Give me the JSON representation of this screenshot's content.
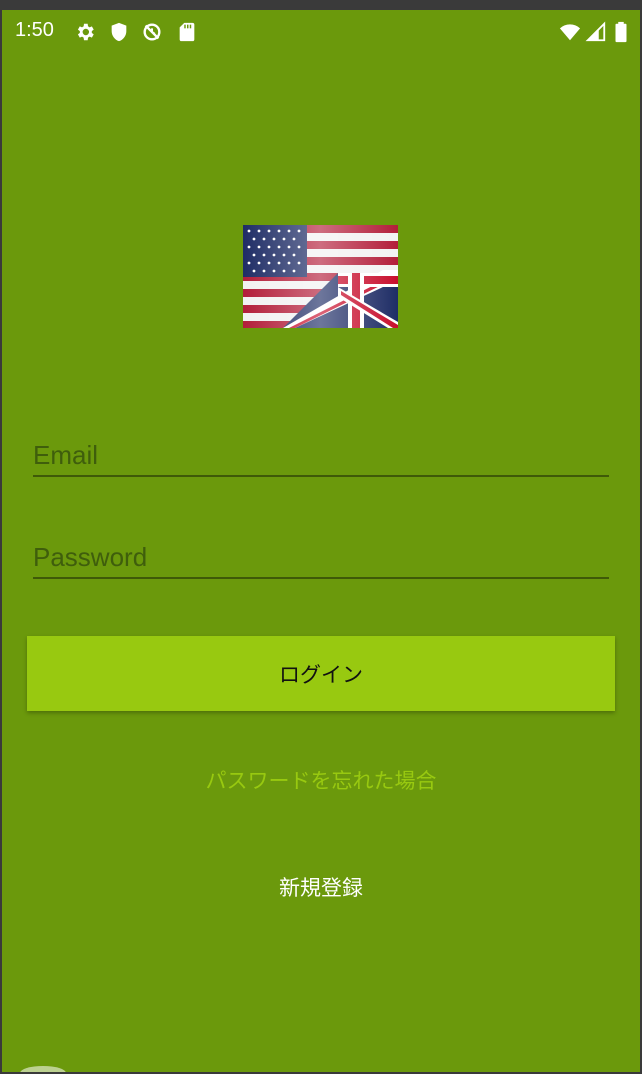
{
  "status_bar": {
    "time": "1:50",
    "left_icons": [
      "gear-icon",
      "shield-icon",
      "no-sync-icon",
      "sd-card-icon"
    ],
    "right_icons": [
      "wifi-icon",
      "signal-icon",
      "battery-icon"
    ]
  },
  "logo": {
    "icon": "us-uk-flag-logo"
  },
  "form": {
    "email_placeholder": "Email",
    "password_placeholder": "Password"
  },
  "actions": {
    "login_label": "ログイン",
    "forgot_label": "パスワードを忘れた場合",
    "register_label": "新規登録"
  },
  "colors": {
    "background": "#6b990c",
    "button": "#98c910",
    "forgot_link": "#98c910",
    "register_link": "#ffffff"
  }
}
